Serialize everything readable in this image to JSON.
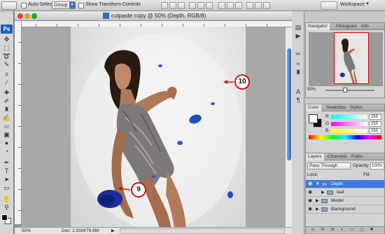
{
  "options_bar": {
    "auto_select_label": "Auto-Select:",
    "auto_select_value": "Group",
    "transform_label": "Show Transform Controls",
    "workspace_label": "Workspace"
  },
  "tools": {
    "logo": "Ps",
    "items": [
      "move",
      "marquee",
      "lasso",
      "quick-select",
      "crop",
      "eyedropper",
      "healing",
      "brush",
      "stamp",
      "history-brush",
      "eraser",
      "gradient",
      "blur",
      "dodge",
      "pen",
      "type",
      "path-select",
      "shape",
      "hand",
      "zoom"
    ]
  },
  "document": {
    "title": "cutpaste copy @ 50% (Depth, RGB/8)",
    "zoom": "50%",
    "doc_size": "Doc: 2.91M/79.6M"
  },
  "callouts": [
    "10",
    "9"
  ],
  "navigator": {
    "tabs": [
      "Navigator",
      "Histogram",
      "Info"
    ],
    "zoom": "50%"
  },
  "color_panel": {
    "tabs": [
      "Color",
      "Swatches",
      "Styles"
    ],
    "channels": [
      {
        "label": "R",
        "value": "255"
      },
      {
        "label": "G",
        "value": "255"
      },
      {
        "label": "B",
        "value": "255"
      }
    ]
  },
  "layers_panel": {
    "tabs": [
      "Layers",
      "Channels",
      "Paths"
    ],
    "blend_mode": "Pass Through",
    "opacity_label": "Opacity:",
    "opacity_value": "100%",
    "lock_label": "Lock:",
    "fill_label": "Fill:",
    "layers": [
      {
        "name": "Depth",
        "selected": true,
        "indent": 0
      },
      {
        "name": "leaf",
        "selected": false,
        "indent": 1
      },
      {
        "name": "Model",
        "selected": false,
        "indent": 0
      },
      {
        "name": "Background",
        "selected": false,
        "indent": 0
      }
    ]
  }
}
